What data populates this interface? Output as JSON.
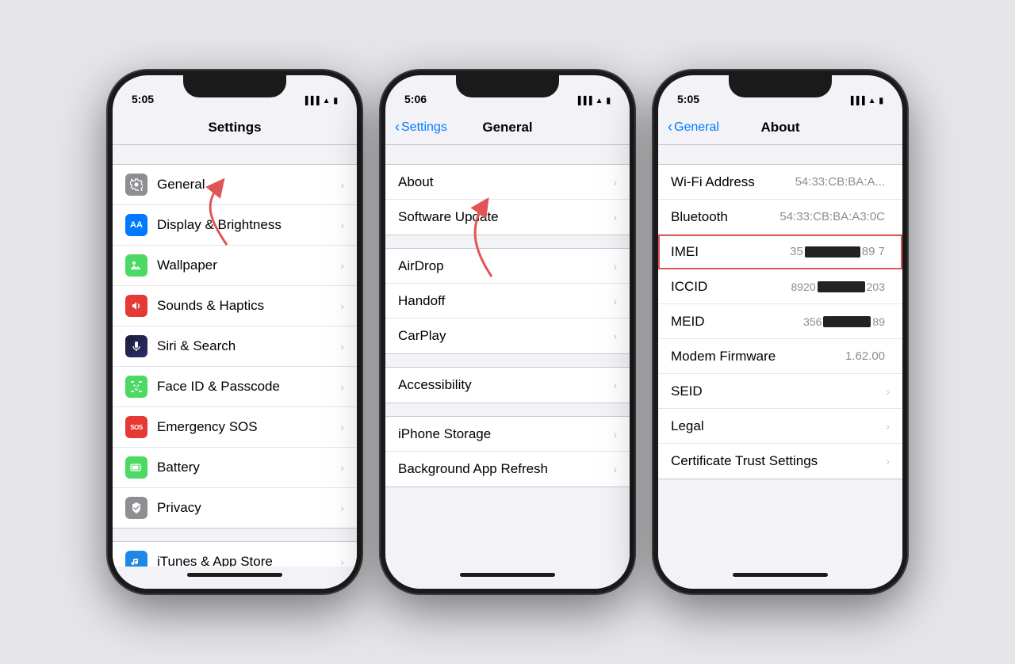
{
  "phones": [
    {
      "id": "phone1",
      "statusTime": "5:05",
      "navTitle": "Settings",
      "navBack": null,
      "sections": [
        {
          "grouped": true,
          "rows": [
            {
              "icon": "gear",
              "iconColor": "#8e8e93",
              "label": "General",
              "hasChevron": true
            },
            {
              "icon": "AA",
              "iconColor": "#007aff",
              "label": "Display & Brightness",
              "hasChevron": true,
              "iconText": "AA"
            },
            {
              "icon": "🌸",
              "iconColor": "#4cd964",
              "label": "Wallpaper",
              "hasChevron": true
            },
            {
              "icon": "🔊",
              "iconColor": "#e53935",
              "label": "Sounds & Haptics",
              "hasChevron": true
            },
            {
              "icon": "siri",
              "iconColor": "#000",
              "label": "Siri & Search",
              "hasChevron": true
            },
            {
              "icon": "faceid",
              "iconColor": "#4cd964",
              "label": "Face ID & Passcode",
              "hasChevron": true
            },
            {
              "icon": "SOS",
              "iconColor": "#e53935",
              "label": "Emergency SOS",
              "hasChevron": true
            },
            {
              "icon": "battery",
              "iconColor": "#4cd964",
              "label": "Battery",
              "hasChevron": true
            },
            {
              "icon": "hand",
              "iconColor": "#8e8e93",
              "label": "Privacy",
              "hasChevron": true
            }
          ]
        },
        {
          "grouped": true,
          "rows": [
            {
              "icon": "itunes",
              "iconColor": "#1e88e5",
              "label": "iTunes & App Store",
              "hasChevron": true
            }
          ]
        }
      ]
    },
    {
      "id": "phone2",
      "statusTime": "5:06",
      "navTitle": "General",
      "navBack": "Settings",
      "sections": [
        {
          "grouped": true,
          "rows": [
            {
              "label": "About",
              "hasChevron": true
            },
            {
              "label": "Software Update",
              "hasChevron": true
            }
          ]
        },
        {
          "grouped": true,
          "rows": [
            {
              "label": "AirDrop",
              "hasChevron": true
            },
            {
              "label": "Handoff",
              "hasChevron": true
            },
            {
              "label": "CarPlay",
              "hasChevron": true
            }
          ]
        },
        {
          "grouped": true,
          "rows": [
            {
              "label": "Accessibility",
              "hasChevron": true
            }
          ]
        },
        {
          "grouped": true,
          "rows": [
            {
              "label": "iPhone Storage",
              "hasChevron": true
            },
            {
              "label": "Background App Refresh",
              "hasChevron": true
            }
          ]
        }
      ]
    },
    {
      "id": "phone3",
      "statusTime": "5:05",
      "navTitle": "About",
      "navBack": "General",
      "sections": [
        {
          "grouped": true,
          "rows": [
            {
              "label": "Wi-Fi Address",
              "value": "54:33:CB:BA:A...",
              "hasChevron": false
            },
            {
              "label": "Bluetooth",
              "value": "54:33:CB:BA:A3:0C",
              "hasChevron": false
            },
            {
              "label": "IMEI",
              "value": "IMEI_REDACTED",
              "hasChevron": false,
              "highlighted": true
            },
            {
              "label": "ICCID",
              "value": "ICCID_REDACTED",
              "hasChevron": false
            },
            {
              "label": "MEID",
              "value": "MEID_REDACTED",
              "hasChevron": false
            },
            {
              "label": "Modem Firmware",
              "value": "1.62.00",
              "hasChevron": false
            },
            {
              "label": "SEID",
              "value": "",
              "hasChevron": true
            },
            {
              "label": "Legal",
              "value": "",
              "hasChevron": true
            },
            {
              "label": "Certificate Trust Settings",
              "value": "",
              "hasChevron": true
            }
          ]
        }
      ]
    }
  ],
  "icons": {
    "chevron": "›",
    "back_chevron": "‹"
  },
  "arrows": [
    {
      "phone": 0,
      "description": "points to General row"
    },
    {
      "phone": 1,
      "description": "points to About row"
    }
  ]
}
